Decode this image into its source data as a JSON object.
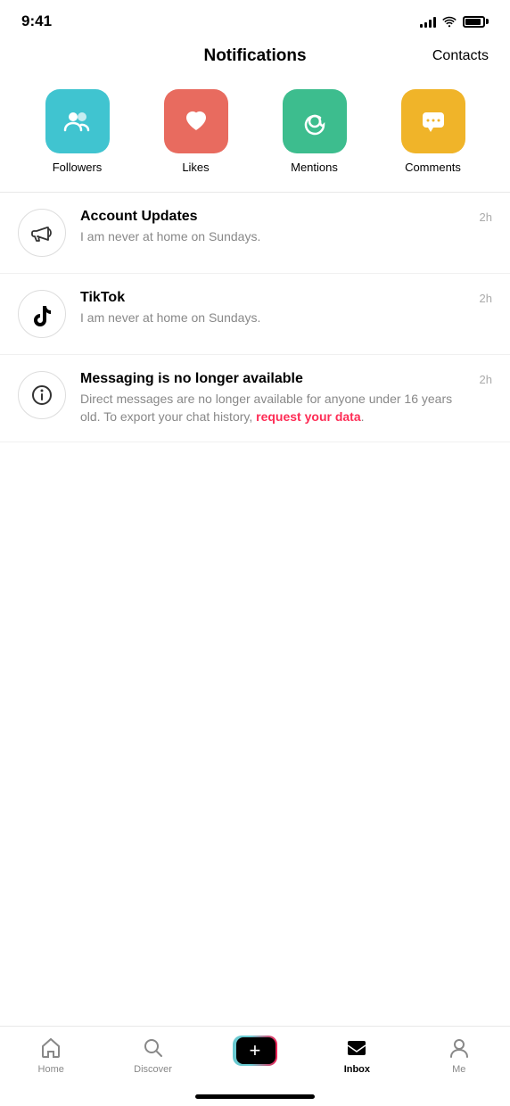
{
  "statusBar": {
    "time": "9:41"
  },
  "header": {
    "title": "Notifications",
    "contactsLabel": "Contacts"
  },
  "categories": [
    {
      "id": "followers",
      "label": "Followers",
      "color": "#40c4d0",
      "icon": "followers"
    },
    {
      "id": "likes",
      "label": "Likes",
      "color": "#e86b5f",
      "icon": "heart"
    },
    {
      "id": "mentions",
      "label": "Mentions",
      "color": "#3dbd8e",
      "icon": "at"
    },
    {
      "id": "comments",
      "label": "Comments",
      "color": "#f0b429",
      "icon": "comment"
    }
  ],
  "notifications": [
    {
      "id": "account-updates",
      "title": "Account Updates",
      "body": "I am never at home on Sundays.",
      "time": "2h",
      "icon": "megaphone"
    },
    {
      "id": "tiktok",
      "title": "TikTok",
      "body": "I am never at home on Sundays.",
      "time": "2h",
      "icon": "tiktok"
    },
    {
      "id": "messaging",
      "title": "Messaging is no longer available",
      "bodyText": "Direct messages are no longer available for anyone under 16 years old. To export your chat history, ",
      "linkText": "request your data",
      "bodyEnd": ".",
      "time": "2h",
      "icon": "info"
    }
  ],
  "bottomNav": {
    "items": [
      {
        "id": "home",
        "label": "Home",
        "active": false,
        "icon": "home"
      },
      {
        "id": "discover",
        "label": "Discover",
        "active": false,
        "icon": "search"
      },
      {
        "id": "create",
        "label": "",
        "active": false,
        "icon": "plus"
      },
      {
        "id": "inbox",
        "label": "Inbox",
        "active": true,
        "icon": "inbox"
      },
      {
        "id": "me",
        "label": "Me",
        "active": false,
        "icon": "person"
      }
    ]
  }
}
